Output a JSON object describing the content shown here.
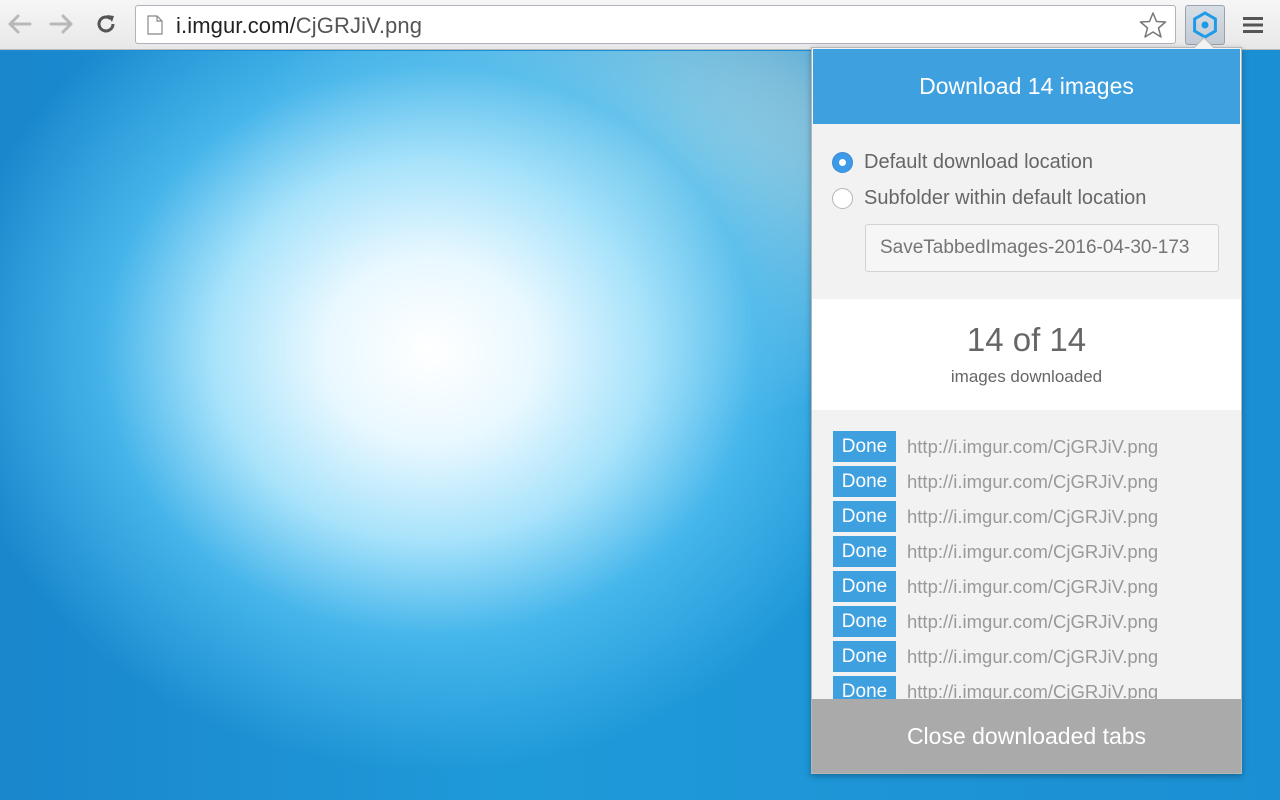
{
  "browser": {
    "url_host": "i.imgur.com/",
    "url_path": "CjGRJiV.png"
  },
  "popup": {
    "download_label": "Download 14 images",
    "options": [
      {
        "label": "Default download location",
        "checked": true
      },
      {
        "label": "Subfolder within default location",
        "checked": false
      }
    ],
    "folder_placeholder": "SaveTabbedImages-2016-04-30-173",
    "progress_count": "14 of 14",
    "progress_label": "images downloaded",
    "rows": [
      {
        "status": "Done",
        "url": "http://i.imgur.com/CjGRJiV.png"
      },
      {
        "status": "Done",
        "url": "http://i.imgur.com/CjGRJiV.png"
      },
      {
        "status": "Done",
        "url": "http://i.imgur.com/CjGRJiV.png"
      },
      {
        "status": "Done",
        "url": "http://i.imgur.com/CjGRJiV.png"
      },
      {
        "status": "Done",
        "url": "http://i.imgur.com/CjGRJiV.png"
      },
      {
        "status": "Done",
        "url": "http://i.imgur.com/CjGRJiV.png"
      },
      {
        "status": "Done",
        "url": "http://i.imgur.com/CjGRJiV.png"
      },
      {
        "status": "Done",
        "url": "http://i.imgur.com/CjGRJiV.png"
      }
    ],
    "close_label": "Close downloaded tabs"
  },
  "colors": {
    "accent": "#3fa0e0",
    "close_button": "#aaaaaa"
  },
  "icons": [
    "back-arrow-icon",
    "forward-arrow-icon",
    "reload-icon",
    "page-icon",
    "star-icon",
    "extension-icon",
    "menu-icon"
  ]
}
